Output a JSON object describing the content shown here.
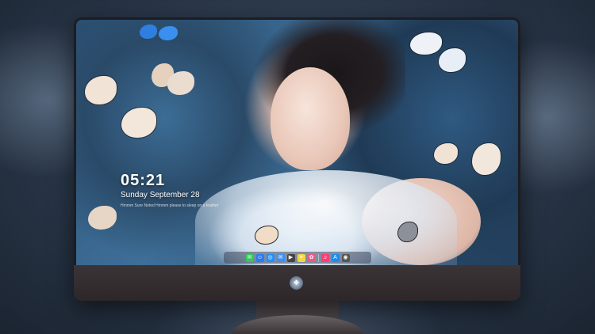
{
  "lockscreen": {
    "time": "05:21",
    "date": "Sunday September 28",
    "subline": "Hmmm Sure Noted Hmmm please to sleep on a feather"
  },
  "dock": {
    "icons": [
      {
        "name": "messages-icon",
        "color": "#34c759",
        "glyph": "✉"
      },
      {
        "name": "finder-icon",
        "color": "#2d7bf0",
        "glyph": "☺"
      },
      {
        "name": "safari-icon",
        "color": "#1e90ff",
        "glyph": "◎"
      },
      {
        "name": "mail-icon",
        "color": "#3d8ef7",
        "glyph": "✉"
      },
      {
        "name": "video-icon",
        "color": "#444444",
        "glyph": "▶"
      },
      {
        "name": "notes-icon",
        "color": "#f5d547",
        "glyph": "≡"
      },
      {
        "name": "photos-icon",
        "color": "#e85a8a",
        "glyph": "✿"
      },
      {
        "name": "music-icon",
        "color": "#fc3c78",
        "glyph": "♫"
      },
      {
        "name": "appstore-icon",
        "color": "#1c8cf0",
        "glyph": "A"
      },
      {
        "name": "camera-icon",
        "color": "#555555",
        "glyph": "◉"
      }
    ]
  },
  "monitor": {
    "logo_glyph": "❖"
  }
}
